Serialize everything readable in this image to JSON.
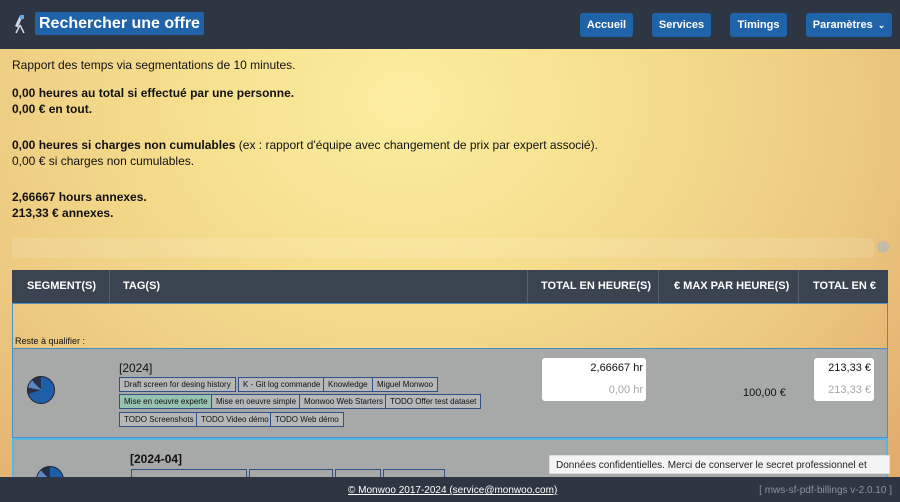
{
  "header": {
    "title": "Rechercher une offre",
    "nav": {
      "accueil": "Accueil",
      "services": "Services",
      "timings": "Timings",
      "parametres": "Paramètres"
    }
  },
  "report": {
    "intro": "Rapport des temps via segmentations de 10 minutes.",
    "total_hours_single": "0,00 heures au total si effectué par une personne.",
    "total_eur_all": "0,00 € en tout.",
    "non_cumulative_hours_bold": "0,00 heures si charges non cumulables",
    "non_cumulative_note": " (ex : rapport d'équipe avec changement de prix par expert associé).",
    "non_cumulative_eur": "0,00 € si charges non cumulables.",
    "annex_hours": "2,66667 hours annexes.",
    "annex_eur": "213,33 € annexes."
  },
  "table": {
    "headers": {
      "segments": "SEGMENT(S)",
      "tags": "TAG(S)",
      "total_hours": "TOTAL EN HEURE(S)",
      "max_per_hour": "€ MAX PAR HEURE(S)",
      "total_eur": "TOTAL EN €"
    },
    "unqualified_label": "Reste à qualifier :",
    "rows": [
      {
        "period": "[2024]",
        "tags": [
          "Draft screen for desing history",
          "K - Git log commande",
          "Knowledge",
          "Miguel Monwoo",
          "Mise en oeuvre experte",
          "Mise en oeuvre simple",
          "Monwoo Web Starters",
          "TODO Offer test dataset",
          "TODO Screenshots",
          "TODO Video démo",
          "TODO Web démo"
        ],
        "hours": "2,66667 hr",
        "hours_secondary": "0,00 hr",
        "max_rate": "100,00 €",
        "total": "213,33 €",
        "total_secondary": "213,33 €"
      },
      {
        "period": "[2024-04]"
      }
    ]
  },
  "toast": "Données confidentielles. Merci de conserver le secret professionnel et privé.",
  "footer": {
    "copyright": "© Monwoo 2017-2024 (service@monwoo.com)",
    "version": "[ mws-sf-pdf-billings v-2.0.10 ]"
  }
}
